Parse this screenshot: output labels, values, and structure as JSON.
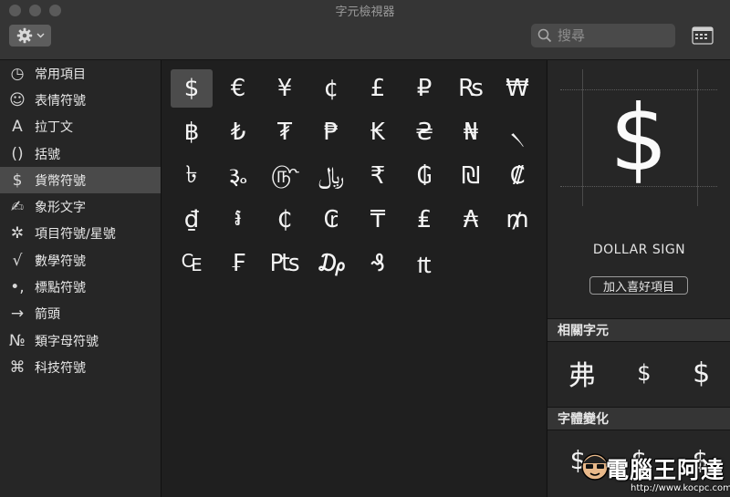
{
  "window": {
    "title": "字元檢視器"
  },
  "toolbar": {
    "gear_icon": "gear-icon",
    "search_placeholder": "搜尋"
  },
  "sidebar": {
    "items": [
      {
        "icon": "◷",
        "label": "常用項目",
        "name": "clock-icon"
      },
      {
        "icon": "☺",
        "label": "表情符號",
        "name": "smiley-icon"
      },
      {
        "icon": "A",
        "label": "拉丁文",
        "name": "latin-a-icon"
      },
      {
        "icon": "()",
        "label": "括號",
        "name": "parentheses-icon"
      },
      {
        "icon": "$",
        "label": "貨幣符號",
        "name": "dollar-icon"
      },
      {
        "icon": "✍",
        "label": "象形文字",
        "name": "pictograph-icon"
      },
      {
        "icon": "✲",
        "label": "項目符號/星號",
        "name": "asterisk-icon"
      },
      {
        "icon": "√",
        "label": "數學符號",
        "name": "sqrt-icon"
      },
      {
        "icon": "•,",
        "label": "標點符號",
        "name": "punctuation-icon"
      },
      {
        "icon": "→",
        "label": "箭頭",
        "name": "arrow-icon"
      },
      {
        "icon": "№",
        "label": "類字母符號",
        "name": "numero-icon"
      },
      {
        "icon": "⌘",
        "label": "科技符號",
        "name": "command-icon"
      }
    ],
    "selected_index": 4
  },
  "glyphs": [
    "$",
    "€",
    "¥",
    "¢",
    "£",
    "₽",
    "₨",
    "₩",
    "฿",
    "₺",
    "₮",
    "₱",
    "₭",
    "₴",
    "₦",
    "৲",
    "৳",
    "૱",
    "௹",
    "﷼",
    "₹",
    "₲",
    "₪",
    "₡",
    "₫",
    "៛",
    "₵",
    "₢",
    "₸",
    "₤",
    "₳",
    "₥",
    "₠",
    "₣",
    "₧",
    "₯",
    "₰",
    "₶"
  ],
  "selected_glyph": 0,
  "detail": {
    "preview": "$",
    "name": "DOLLAR SIGN",
    "fav_button": "加入喜好項目",
    "related_header": "相關字元",
    "related": [
      "弗",
      "$",
      "$"
    ],
    "variants_header": "字體變化",
    "variants": [
      "$",
      "$",
      "$"
    ]
  },
  "watermark": {
    "text": "電腦王阿達",
    "url": "http://www.kocpc.com.tw"
  }
}
